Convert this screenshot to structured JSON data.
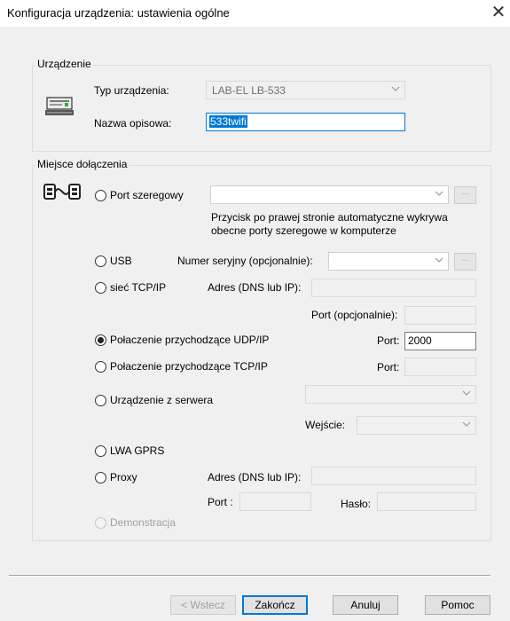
{
  "window": {
    "title": "Konfiguracja urządzenia: ustawienia ogólne",
    "close_glyph": "✕"
  },
  "device_group": {
    "legend": "Urządzenie",
    "type_label": "Typ urządzenia:",
    "type_value": "LAB-EL LB-533",
    "name_label": "Nazwa opisowa:",
    "name_value": "533twifi"
  },
  "connection_group": {
    "legend": "Miejsce dołączenia",
    "serial": {
      "label": "Port szeregowy",
      "browse": "...",
      "hint_line1": "Przycisk po prawej stronie automatyczne wykrywa",
      "hint_line2": "obecne porty szeregowe w komputerze"
    },
    "usb": {
      "label": "USB",
      "serial_label": "Numer seryjny (opcjonalnie):",
      "browse": "..."
    },
    "tcpip": {
      "label": "sieć TCP/IP",
      "address_label": "Adres (DNS lub IP):",
      "port_label": "Port (opcjonalnie):"
    },
    "udp_incoming": {
      "label": "Połaczenie przychodzące UDP/IP",
      "port_label": "Port:",
      "port_value": "2000"
    },
    "tcp_incoming": {
      "label": "Połaczenie przychodzące TCP/IP",
      "port_label": "Port:"
    },
    "server": {
      "label": "Urządzenie z serwera",
      "input_label": "Wejście:"
    },
    "gprs": {
      "label": "LWA GPRS"
    },
    "proxy": {
      "label": "Proxy",
      "address_label": "Adres (DNS lub IP):",
      "port_label": "Port :",
      "password_label": "Hasło:"
    },
    "demo": {
      "label": "Demonstracja"
    },
    "selected": "udp_incoming"
  },
  "buttons": {
    "back": "< Wstecz",
    "finish": "Zakończ",
    "cancel": "Anuluj",
    "help": "Pomoc"
  },
  "icons": [
    "device-icon",
    "connection-icon",
    "chevron-down-icon",
    "close-icon"
  ]
}
